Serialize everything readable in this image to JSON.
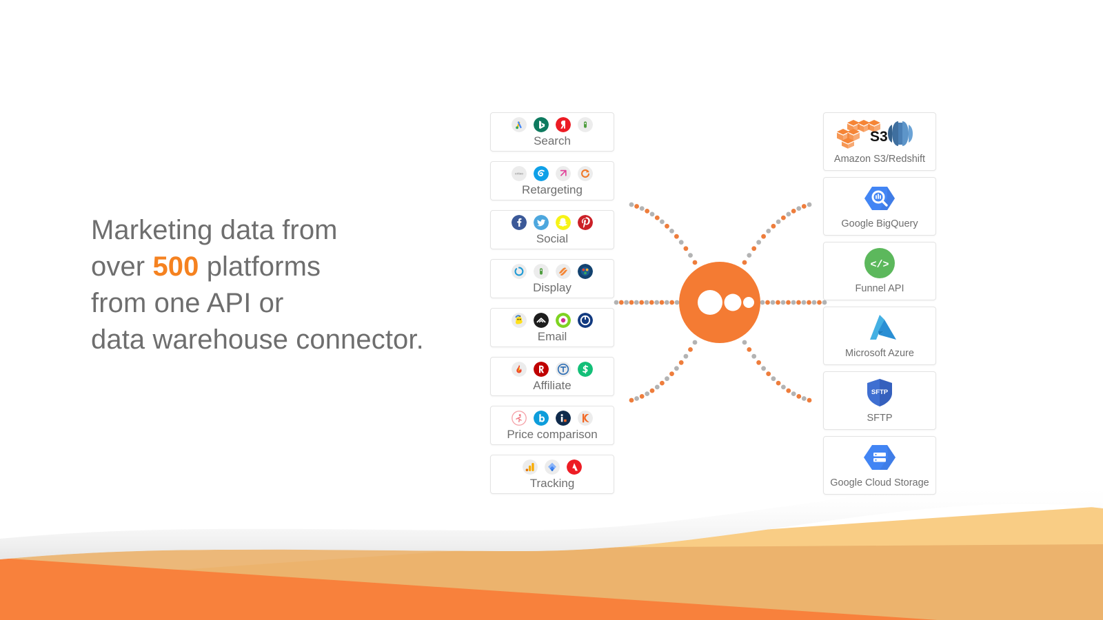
{
  "colors": {
    "orange": "#f47b33",
    "orange_light": "#f9cd85",
    "orange_mid": "#eab06a",
    "orange_bright": "#f8813c",
    "accent_text": "#f58220",
    "body_text": "#6e6e6e",
    "dot_gray": "#b3b3b3",
    "dot_orange": "#ee7d3c",
    "card_border": "#e3e3e3"
  },
  "headline": {
    "line1": "Marketing data from",
    "line2_pre": "over ",
    "line2_accent": "500",
    "line2_post": " platforms",
    "line3": "from one API or",
    "line4": "data warehouse connector."
  },
  "sources": {
    "cards": [
      {
        "label": "Search",
        "icons": [
          {
            "name": "google-ads-icon",
            "kind": "google-ads"
          },
          {
            "name": "bing-ads-icon",
            "kind": "bing"
          },
          {
            "name": "yandex-direct-icon",
            "kind": "yandex"
          },
          {
            "name": "search-platform-icon",
            "kind": "dot-green"
          }
        ]
      },
      {
        "label": "Retargeting",
        "icons": [
          {
            "name": "criteo-icon",
            "kind": "criteo"
          },
          {
            "name": "adroll-icon",
            "kind": "adroll"
          },
          {
            "name": "adform-icon",
            "kind": "adform"
          },
          {
            "name": "retargeting-platform-icon",
            "kind": "swirl-orange"
          }
        ]
      },
      {
        "label": "Social",
        "icons": [
          {
            "name": "facebook-icon",
            "kind": "facebook"
          },
          {
            "name": "twitter-icon",
            "kind": "twitter"
          },
          {
            "name": "snapchat-icon",
            "kind": "snapchat"
          },
          {
            "name": "pinterest-icon",
            "kind": "pinterest"
          }
        ]
      },
      {
        "label": "Display",
        "icons": [
          {
            "name": "display-ring-icon",
            "kind": "ring-blue"
          },
          {
            "name": "display-platform-icon",
            "kind": "dot-green"
          },
          {
            "name": "sizmek-icon",
            "kind": "sizmek"
          },
          {
            "name": "display-network-icon",
            "kind": "globe-blue"
          }
        ]
      },
      {
        "label": "Email",
        "icons": [
          {
            "name": "mailchimp-icon",
            "kind": "mailchimp"
          },
          {
            "name": "campaign-monitor-icon",
            "kind": "campaignmonitor"
          },
          {
            "name": "klaviyo-icon",
            "kind": "ring-green"
          },
          {
            "name": "emarsys-icon",
            "kind": "emarsys"
          }
        ]
      },
      {
        "label": "Affiliate",
        "icons": [
          {
            "name": "affiliate-flame-icon",
            "kind": "flame"
          },
          {
            "name": "rakuten-icon",
            "kind": "rakuten"
          },
          {
            "name": "tradedoubler-icon",
            "kind": "tradedoubler"
          },
          {
            "name": "shareasale-icon",
            "kind": "shareasale"
          }
        ]
      },
      {
        "label": "Price comparison",
        "icons": [
          {
            "name": "kelkoo-runner-icon",
            "kind": "runner"
          },
          {
            "name": "bizrate-icon",
            "kind": "b-blue"
          },
          {
            "name": "idealo-icon",
            "kind": "idealo"
          },
          {
            "name": "kelkoo-icon",
            "kind": "kelkoo"
          }
        ]
      },
      {
        "label": "Tracking",
        "icons": [
          {
            "name": "google-analytics-icon",
            "kind": "ganalytics"
          },
          {
            "name": "google-tag-manager-icon",
            "kind": "gtm"
          },
          {
            "name": "adobe-analytics-icon",
            "kind": "adobe"
          }
        ]
      }
    ]
  },
  "destinations": {
    "cards": [
      {
        "label": "Amazon S3/Redshift",
        "logo": "amazon-s3-redshift-logo"
      },
      {
        "label": "Google BigQuery",
        "logo": "google-bigquery-logo"
      },
      {
        "label": "Funnel API",
        "logo": "funnel-api-logo"
      },
      {
        "label": "Microsoft Azure",
        "logo": "microsoft-azure-logo"
      },
      {
        "label": "SFTP",
        "logo": "sftp-logo"
      },
      {
        "label": "Google Cloud Storage",
        "logo": "google-cloud-storage-logo"
      }
    ]
  },
  "hub": {
    "name": "funnel-hub-node",
    "dot_count": 3
  }
}
